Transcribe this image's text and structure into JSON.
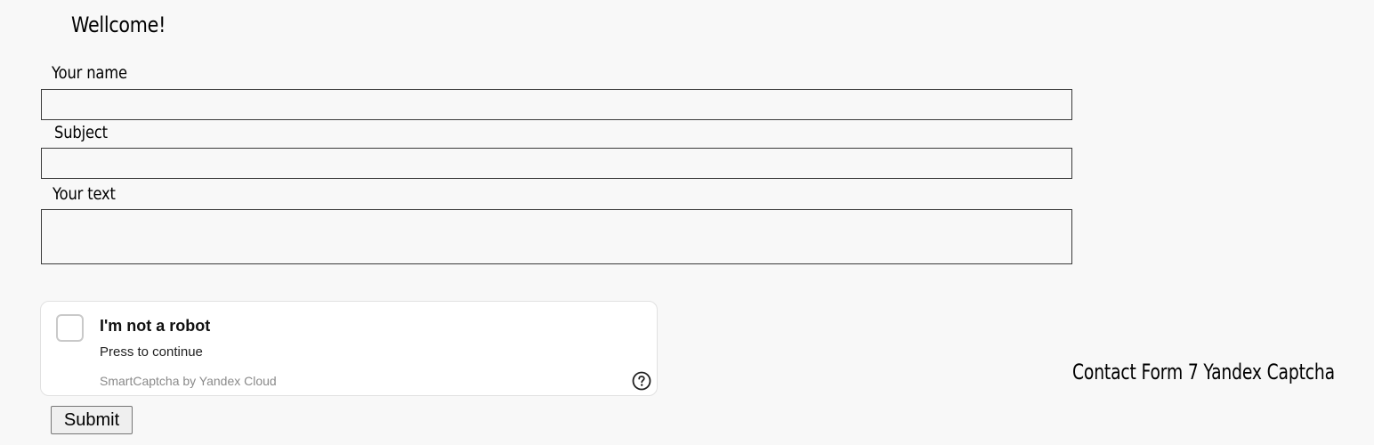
{
  "header": {
    "greeting": "Wellcome!"
  },
  "form": {
    "name_label": "Your name",
    "name_value": "",
    "subject_label": "Subject",
    "subject_value": "",
    "text_label": "Your text",
    "text_value": "",
    "submit_label": "Submit"
  },
  "captcha": {
    "checked": false,
    "title": "I'm not a robot",
    "subtitle": "Press to continue",
    "brand": "SmartCaptcha by Yandex Cloud",
    "help_icon": "question-circle-icon"
  },
  "footer": {
    "note": "Contact Form 7 Yandex Captcha"
  }
}
